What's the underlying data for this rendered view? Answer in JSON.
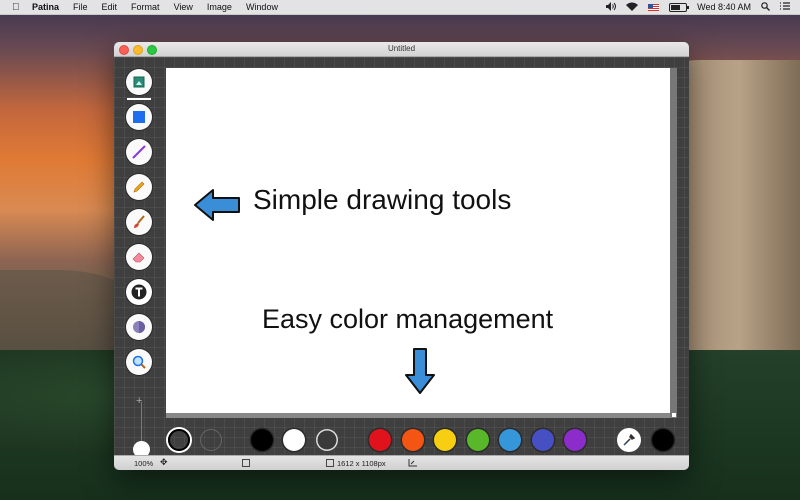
{
  "menubar": {
    "app_name": "Patina",
    "menus": [
      "File",
      "Edit",
      "Format",
      "View",
      "Image",
      "Window"
    ],
    "clock": "Wed 8:40 AM"
  },
  "window": {
    "title": "Untitled"
  },
  "canvas": {
    "caption_tools": "Simple drawing tools",
    "caption_colors": "Easy color management"
  },
  "tools": [
    {
      "name": "layers-tool-icon"
    },
    {
      "name": "shape-tool-icon"
    },
    {
      "name": "line-tool-icon"
    },
    {
      "name": "pencil-tool-icon"
    },
    {
      "name": "brush-tool-icon"
    },
    {
      "name": "eraser-tool-icon"
    },
    {
      "name": "text-tool-icon"
    },
    {
      "name": "fill-tool-icon"
    },
    {
      "name": "zoom-tool-icon"
    }
  ],
  "palette": {
    "colors": [
      "#000000",
      "#ffffff",
      "#3a3a3a",
      "#e0131d",
      "#f45513",
      "#f7ce12",
      "#58b82a",
      "#3596d9",
      "#4650c2",
      "#8c2ccb"
    ],
    "current_color": "#000000"
  },
  "status": {
    "zoom": "100%",
    "canvas_size": "1612 x 1108px"
  }
}
